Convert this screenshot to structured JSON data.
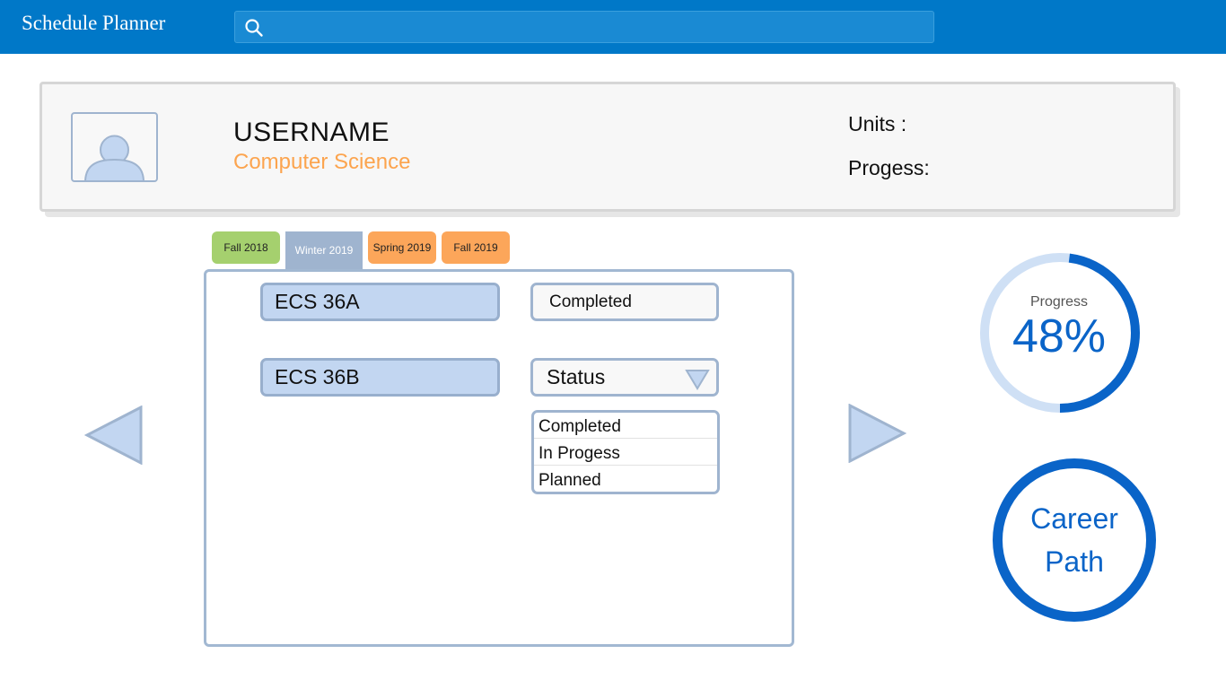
{
  "app": {
    "title": "Schedule Planner"
  },
  "search": {
    "placeholder": ""
  },
  "profile": {
    "username": "USERNAME",
    "major": "Computer Science",
    "units_label": "Units :",
    "progress_label": "Progess:"
  },
  "tabs": [
    {
      "label": "Fall 2018",
      "color": "#a5d06e"
    },
    {
      "label": "Winter 2019",
      "color": "#9fb4cf",
      "active": true
    },
    {
      "label": "Spring 2019",
      "color": "#fca65a"
    },
    {
      "label": "Fall 2019",
      "color": "#fca65a"
    }
  ],
  "courses": [
    {
      "code": "ECS 36A",
      "status": "Completed"
    },
    {
      "code": "ECS 36B",
      "status": "Status"
    }
  ],
  "status_options": [
    "Completed",
    "In Progess",
    "Planned"
  ],
  "progress_widget": {
    "label": "Progress",
    "value_text": "48%",
    "value": 0.48
  },
  "career": {
    "line1": "Career",
    "line2": "Path"
  },
  "colors": {
    "header": "#0078c8",
    "accent": "#0a64c8",
    "major": "#fca44e",
    "panel_border": "#a2b8d2",
    "course_fill": "#c2d6f1"
  },
  "icons": {
    "search": "search-icon",
    "avatar": "user-avatar-icon",
    "dropdown": "triangle-down-icon",
    "prev": "triangle-left-icon",
    "next": "triangle-right-icon"
  }
}
